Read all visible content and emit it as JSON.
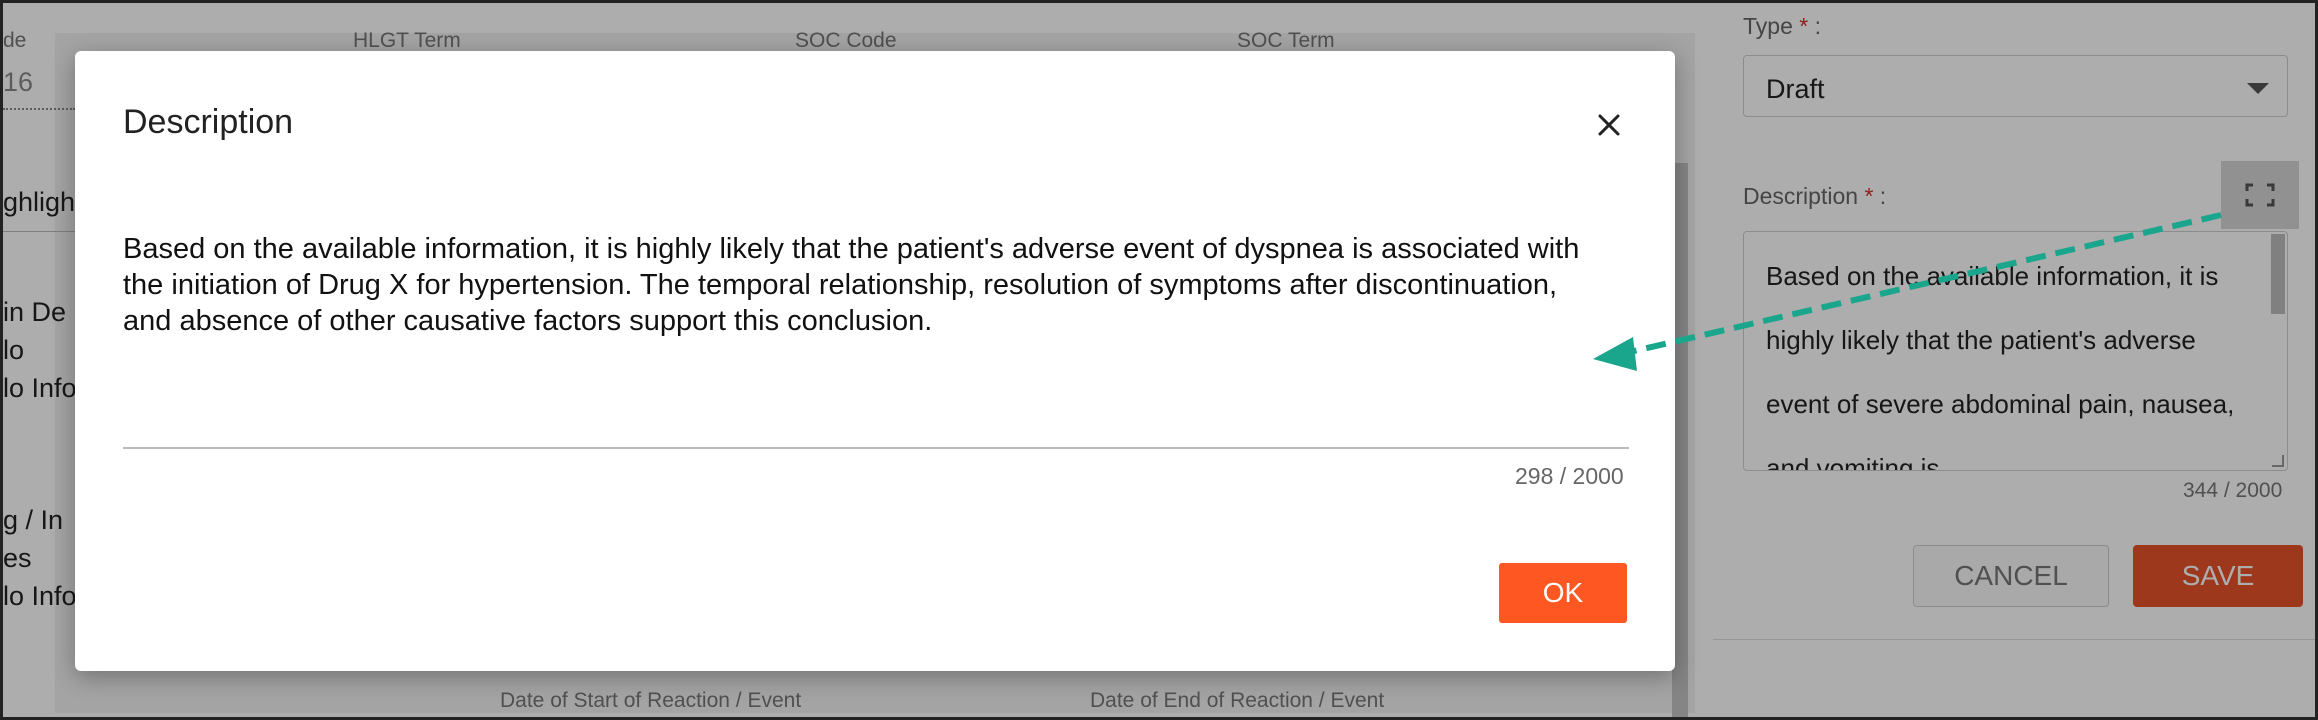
{
  "background": {
    "headers": [
      "de",
      "HLGT Term",
      "SOC Code",
      "SOC Term"
    ],
    "partial_value": "16",
    "side_texts": [
      "ghligh",
      "in De",
      "lo",
      "lo Info",
      "g / In",
      "es",
      "lo Info"
    ],
    "footer_labels": [
      "Date of Start of Reaction / Event",
      "Date of End of Reaction / Event"
    ]
  },
  "right_panel": {
    "type_label": "Type",
    "type_required": "*",
    "type_suffix": " :",
    "type_value": "Draft",
    "description_label": "Description",
    "description_required": "*",
    "description_suffix": " :",
    "description_text": "Based on the available information, it is highly likely that the patient's adverse event of severe abdominal pain, nausea, and vomiting is",
    "char_count": "344 / 2000",
    "cancel_label": "CANCEL",
    "save_label": "SAVE"
  },
  "modal": {
    "title": "Description",
    "body_text": "Based on the available information, it is highly likely that the patient's adverse event of dyspnea is associated with the initiation of Drug X for hypertension. The temporal relationship, resolution of symptoms after discontinuation, and absence of other causative factors support this conclusion.",
    "char_count": "298 / 2000",
    "ok_label": "OK"
  },
  "colors": {
    "accent": "#ff5722",
    "required": "#d32f2f",
    "annotation_arrow": "#1aa68c"
  }
}
